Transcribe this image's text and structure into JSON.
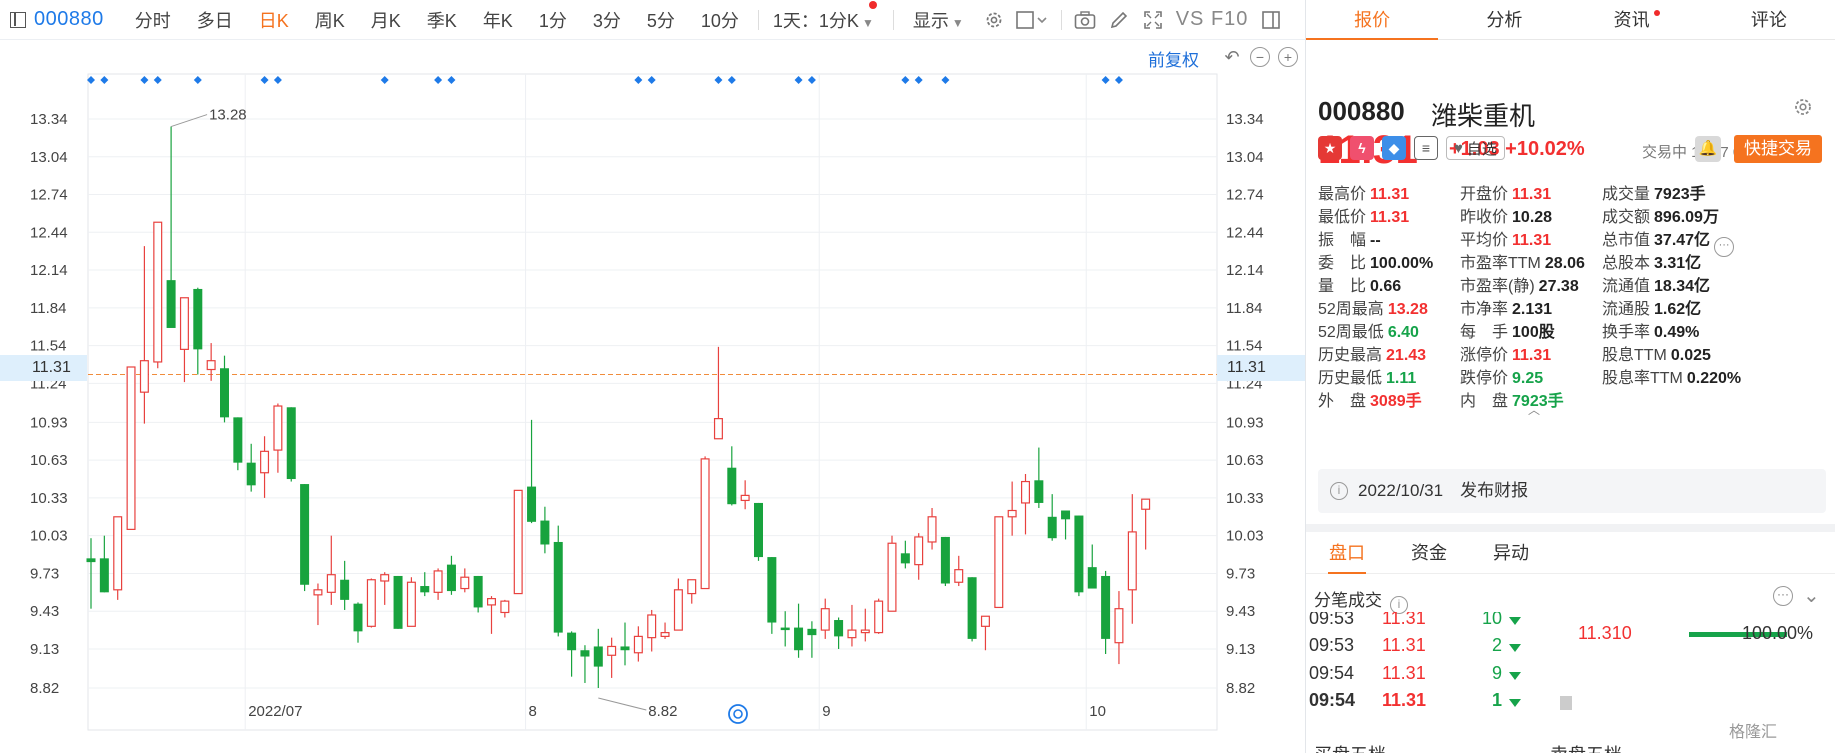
{
  "toolbar": {
    "code": "000880",
    "tabs": [
      "分时",
      "多日",
      "日K",
      "周K",
      "月K",
      "季K",
      "年K",
      "1分",
      "3分",
      "5分",
      "10分"
    ],
    "active_tab": "日K",
    "interval_select": "1天：1分K",
    "display": "显示",
    "vsf10": "VS F10"
  },
  "adjust": {
    "label": "前复权"
  },
  "chart_data": {
    "type": "candlestick",
    "title": "",
    "y_ticks": [
      13.34,
      13.04,
      12.74,
      12.44,
      12.14,
      11.84,
      11.54,
      11.24,
      10.93,
      10.63,
      10.33,
      10.03,
      9.73,
      9.43,
      9.13,
      8.82
    ],
    "y_tick_labels": [
      "13.34",
      "13.04",
      "12.74",
      "12.44",
      "12.14",
      "11.84",
      "11.54",
      "11.24",
      "10.93",
      "10.63",
      "10.33",
      "10.03",
      "9.73",
      "9.43",
      "9.13",
      "8.82"
    ],
    "ylim": [
      8.82,
      13.34
    ],
    "current_price": 11.31,
    "current_price_label": "11.31",
    "high_marker": {
      "value": 13.28,
      "label": "13.28",
      "index": 6
    },
    "low_marker": {
      "value": 8.82,
      "label": "8.82",
      "index": 38
    },
    "x_labels": [
      {
        "label": "2022/07",
        "index": 12
      },
      {
        "label": "8",
        "index": 33
      },
      {
        "label": "9",
        "index": 55
      },
      {
        "label": "10",
        "index": 75
      }
    ],
    "event_indices": [
      0,
      1,
      4,
      5,
      8,
      13,
      14,
      22,
      26,
      27,
      41,
      42,
      47,
      48,
      53,
      54,
      61,
      62,
      64,
      76,
      77
    ],
    "candles": [
      {
        "o": 9.85,
        "h": 10.01,
        "l": 9.45,
        "c": 9.82
      },
      {
        "o": 9.85,
        "h": 10.03,
        "l": 9.58,
        "c": 9.58
      },
      {
        "o": 9.6,
        "h": 10.18,
        "l": 9.52,
        "c": 10.18
      },
      {
        "o": 10.08,
        "h": 11.37,
        "l": 10.08,
        "c": 11.37
      },
      {
        "o": 11.17,
        "h": 12.33,
        "l": 10.92,
        "c": 11.42
      },
      {
        "o": 11.41,
        "h": 12.52,
        "l": 11.36,
        "c": 12.52
      },
      {
        "o": 12.06,
        "h": 13.28,
        "l": 11.76,
        "c": 11.68
      },
      {
        "o": 11.51,
        "h": 11.92,
        "l": 11.25,
        "c": 11.92
      },
      {
        "o": 11.99,
        "h": 12.0,
        "l": 11.31,
        "c": 11.51
      },
      {
        "o": 11.35,
        "h": 11.56,
        "l": 11.26,
        "c": 11.42
      },
      {
        "o": 11.36,
        "h": 11.46,
        "l": 10.93,
        "c": 10.97
      },
      {
        "o": 10.97,
        "h": 10.97,
        "l": 10.55,
        "c": 10.61
      },
      {
        "o": 10.61,
        "h": 10.76,
        "l": 10.38,
        "c": 10.43
      },
      {
        "o": 10.53,
        "h": 10.82,
        "l": 10.33,
        "c": 10.7
      },
      {
        "o": 10.71,
        "h": 11.08,
        "l": 10.53,
        "c": 11.06
      },
      {
        "o": 11.05,
        "h": 11.05,
        "l": 10.46,
        "c": 10.48
      },
      {
        "o": 10.44,
        "h": 10.44,
        "l": 9.59,
        "c": 9.64
      },
      {
        "o": 9.56,
        "h": 9.65,
        "l": 9.32,
        "c": 9.6
      },
      {
        "o": 9.58,
        "h": 10.03,
        "l": 9.48,
        "c": 9.72
      },
      {
        "o": 9.68,
        "h": 9.83,
        "l": 9.44,
        "c": 9.52
      },
      {
        "o": 9.49,
        "h": 9.5,
        "l": 9.18,
        "c": 9.27
      },
      {
        "o": 9.31,
        "h": 9.69,
        "l": 9.3,
        "c": 9.68
      },
      {
        "o": 9.67,
        "h": 9.74,
        "l": 9.48,
        "c": 9.72
      },
      {
        "o": 9.71,
        "h": 9.71,
        "l": 9.29,
        "c": 9.29
      },
      {
        "o": 9.31,
        "h": 9.7,
        "l": 9.31,
        "c": 9.66
      },
      {
        "o": 9.63,
        "h": 9.74,
        "l": 9.55,
        "c": 9.58
      },
      {
        "o": 9.58,
        "h": 9.77,
        "l": 9.52,
        "c": 9.75
      },
      {
        "o": 9.8,
        "h": 9.87,
        "l": 9.56,
        "c": 9.59
      },
      {
        "o": 9.61,
        "h": 9.77,
        "l": 9.58,
        "c": 9.7
      },
      {
        "o": 9.71,
        "h": 9.71,
        "l": 9.42,
        "c": 9.46
      },
      {
        "o": 9.48,
        "h": 9.55,
        "l": 9.25,
        "c": 9.53
      },
      {
        "o": 9.42,
        "h": 9.52,
        "l": 9.38,
        "c": 9.51
      },
      {
        "o": 9.57,
        "h": 10.39,
        "l": 9.58,
        "c": 10.39
      },
      {
        "o": 10.42,
        "h": 10.95,
        "l": 10.13,
        "c": 10.14
      },
      {
        "o": 10.15,
        "h": 10.26,
        "l": 9.89,
        "c": 9.96
      },
      {
        "o": 9.98,
        "h": 10.11,
        "l": 9.23,
        "c": 9.26
      },
      {
        "o": 9.26,
        "h": 9.27,
        "l": 8.91,
        "c": 9.12
      },
      {
        "o": 9.12,
        "h": 9.16,
        "l": 8.86,
        "c": 9.07
      },
      {
        "o": 9.15,
        "h": 9.29,
        "l": 8.82,
        "c": 8.99
      },
      {
        "o": 9.08,
        "h": 9.22,
        "l": 8.9,
        "c": 9.15
      },
      {
        "o": 9.15,
        "h": 9.34,
        "l": 9.0,
        "c": 9.12
      },
      {
        "o": 9.1,
        "h": 9.31,
        "l": 9.03,
        "c": 9.23
      },
      {
        "o": 9.22,
        "h": 9.44,
        "l": 9.11,
        "c": 9.4
      },
      {
        "o": 9.23,
        "h": 9.34,
        "l": 9.21,
        "c": 9.26
      },
      {
        "o": 9.28,
        "h": 9.69,
        "l": 9.28,
        "c": 9.6
      },
      {
        "o": 9.57,
        "h": 9.68,
        "l": 9.49,
        "c": 9.68
      },
      {
        "o": 9.61,
        "h": 10.66,
        "l": 9.62,
        "c": 10.64
      },
      {
        "o": 10.8,
        "h": 11.53,
        "l": 10.81,
        "c": 10.96
      },
      {
        "o": 10.57,
        "h": 10.74,
        "l": 10.27,
        "c": 10.28
      },
      {
        "o": 10.31,
        "h": 10.47,
        "l": 10.24,
        "c": 10.35
      },
      {
        "o": 10.29,
        "h": 10.29,
        "l": 9.83,
        "c": 9.86
      },
      {
        "o": 9.86,
        "h": 9.86,
        "l": 9.25,
        "c": 9.34
      },
      {
        "o": 9.3,
        "h": 9.43,
        "l": 9.15,
        "c": 9.28
      },
      {
        "o": 9.3,
        "h": 9.49,
        "l": 9.06,
        "c": 9.12
      },
      {
        "o": 9.29,
        "h": 9.35,
        "l": 9.06,
        "c": 9.24
      },
      {
        "o": 9.28,
        "h": 9.53,
        "l": 9.21,
        "c": 9.45
      },
      {
        "o": 9.36,
        "h": 9.38,
        "l": 9.13,
        "c": 9.23
      },
      {
        "o": 9.22,
        "h": 9.48,
        "l": 9.15,
        "c": 9.28
      },
      {
        "o": 9.26,
        "h": 9.45,
        "l": 9.19,
        "c": 9.28
      },
      {
        "o": 9.26,
        "h": 9.53,
        "l": 9.25,
        "c": 9.51
      },
      {
        "o": 9.43,
        "h": 10.03,
        "l": 9.53,
        "c": 9.97
      },
      {
        "o": 9.89,
        "h": 9.99,
        "l": 9.77,
        "c": 9.81
      },
      {
        "o": 9.8,
        "h": 10.05,
        "l": 9.68,
        "c": 10.02
      },
      {
        "o": 9.98,
        "h": 10.25,
        "l": 9.92,
        "c": 10.18
      },
      {
        "o": 10.02,
        "h": 10.02,
        "l": 9.63,
        "c": 9.65
      },
      {
        "o": 9.66,
        "h": 9.87,
        "l": 9.63,
        "c": 9.76
      },
      {
        "o": 9.7,
        "h": 9.7,
        "l": 9.19,
        "c": 9.21
      },
      {
        "o": 9.31,
        "h": 9.37,
        "l": 9.12,
        "c": 9.39
      },
      {
        "o": 9.46,
        "h": 10.18,
        "l": 9.46,
        "c": 10.18
      },
      {
        "o": 10.18,
        "h": 10.46,
        "l": 10.03,
        "c": 10.23
      },
      {
        "o": 10.29,
        "h": 10.52,
        "l": 10.04,
        "c": 10.46
      },
      {
        "o": 10.47,
        "h": 10.73,
        "l": 10.25,
        "c": 10.29
      },
      {
        "o": 10.18,
        "h": 10.36,
        "l": 9.99,
        "c": 10.01
      },
      {
        "o": 10.23,
        "h": 10.23,
        "l": 10.0,
        "c": 10.16
      },
      {
        "o": 10.19,
        "h": 10.19,
        "l": 9.55,
        "c": 9.58
      },
      {
        "o": 9.78,
        "h": 9.96,
        "l": 9.67,
        "c": 9.61
      },
      {
        "o": 9.71,
        "h": 9.75,
        "l": 9.09,
        "c": 9.21
      },
      {
        "o": 9.18,
        "h": 9.59,
        "l": 9.01,
        "c": 9.45
      },
      {
        "o": 9.6,
        "h": 10.36,
        "l": 9.33,
        "c": 10.06
      },
      {
        "o": 10.24,
        "h": 10.29,
        "l": 9.92,
        "c": 10.32
      }
    ]
  },
  "tabs": [
    "报价",
    "分析",
    "资讯",
    "评论"
  ],
  "active_tab": "报价",
  "stock": {
    "code": "000880",
    "name": "潍柴重机",
    "price": "11.31",
    "change": "+1.03 +10.02%",
    "time": "交易中 10/27 09:54(北京)",
    "watch": "自选",
    "quick_trade": "快捷交易"
  },
  "quote_grid": [
    [
      {
        "label": "最高价",
        "value": "11.31",
        "color": "red"
      },
      {
        "label": "开盘价",
        "value": "11.31",
        "color": "red"
      },
      {
        "label": "成交量",
        "value": "7923手",
        "color": ""
      }
    ],
    [
      {
        "label": "最低价",
        "value": "11.31",
        "color": "red"
      },
      {
        "label": "昨收价",
        "value": "10.28",
        "color": ""
      },
      {
        "label": "成交额",
        "value": "896.09万",
        "color": ""
      }
    ],
    [
      {
        "label": "振　幅",
        "value": "--",
        "color": ""
      },
      {
        "label": "平均价",
        "value": "11.31",
        "color": "red"
      },
      {
        "label": "总市值",
        "value": "37.47亿",
        "color": ""
      }
    ],
    [
      {
        "label": "委　比",
        "value": "100.00%",
        "color": ""
      },
      {
        "label": "市盈率TTM",
        "value": "28.06",
        "color": ""
      },
      {
        "label": "总股本",
        "value": "3.31亿",
        "color": ""
      }
    ],
    [
      {
        "label": "量　比",
        "value": "0.66",
        "color": ""
      },
      {
        "label": "市盈率(静)",
        "value": "27.38",
        "color": ""
      },
      {
        "label": "流通值",
        "value": "18.34亿",
        "color": ""
      }
    ],
    [
      {
        "label": "52周最高",
        "value": "13.28",
        "color": "red"
      },
      {
        "label": "市净率",
        "value": "2.131",
        "color": ""
      },
      {
        "label": "流通股",
        "value": "1.62亿",
        "color": ""
      }
    ],
    [
      {
        "label": "52周最低",
        "value": "6.40",
        "color": "green"
      },
      {
        "label": "每　手",
        "value": "100股",
        "color": ""
      },
      {
        "label": "换手率",
        "value": "0.49%",
        "color": ""
      }
    ],
    [
      {
        "label": "历史最高",
        "value": "21.43",
        "color": "red"
      },
      {
        "label": "涨停价",
        "value": "11.31",
        "color": "red"
      },
      {
        "label": "股息TTM",
        "value": "0.025",
        "color": ""
      }
    ],
    [
      {
        "label": "历史最低",
        "value": "1.11",
        "color": "green"
      },
      {
        "label": "跌停价",
        "value": "9.25",
        "color": "green"
      },
      {
        "label": "股息率TTM",
        "value": "0.220%",
        "color": ""
      }
    ],
    [
      {
        "label": "外　盘",
        "value": "3089手",
        "color": "red"
      },
      {
        "label": "内　盘",
        "value": "7923手",
        "color": "green"
      },
      {
        "label": "",
        "value": "",
        "color": ""
      }
    ]
  ],
  "report": "2022/10/31　发布财报",
  "subtabs": [
    "盘口",
    "资金",
    "异动"
  ],
  "active_subtab": "盘口",
  "ticks_title": "分笔成交",
  "ticks": [
    {
      "time": "09:53",
      "price": "11.31",
      "vol": "10"
    },
    {
      "time": "09:53",
      "price": "11.31",
      "vol": "2"
    },
    {
      "time": "09:54",
      "price": "11.31",
      "vol": "9"
    },
    {
      "time": "09:54",
      "price": "11.31",
      "vol": "1"
    }
  ],
  "level": {
    "price": "11.310",
    "pct": "100.00%"
  },
  "bottom": {
    "buy": "买盘五档",
    "sell": "卖盘五档"
  },
  "watermark": "格隆汇"
}
